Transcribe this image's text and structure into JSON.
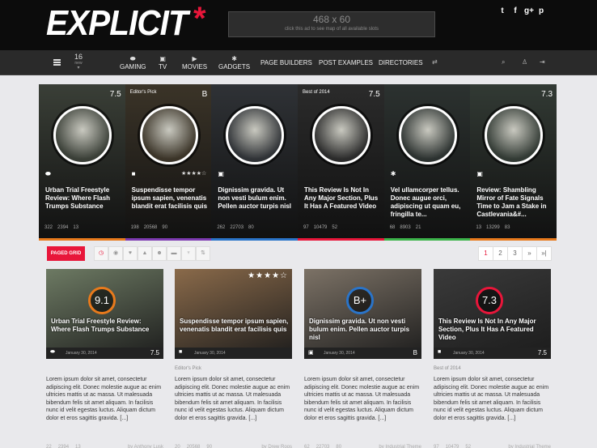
{
  "logo": {
    "text": "EXPLICIT",
    "star": "*"
  },
  "ad": {
    "size": "468 x 60",
    "note": "click this ad to see map of all available slots"
  },
  "social": [
    "t",
    "f",
    "g+",
    "p"
  ],
  "nav": {
    "counter": "16",
    "counter_sub": "new",
    "items": [
      {
        "label": "GAMING",
        "icon": "gamepad-icon",
        "glyph": "⬬"
      },
      {
        "label": "TV",
        "icon": "tv-icon",
        "glyph": "▣"
      },
      {
        "label": "MOVIES",
        "icon": "film-icon",
        "glyph": "▶"
      },
      {
        "label": "GADGETS",
        "icon": "gear-icon",
        "glyph": "✱"
      }
    ],
    "links": [
      "PAGE BUILDERS",
      "POST EXAMPLES",
      "DIRECTORIES"
    ]
  },
  "board": [
    {
      "score": "7.5",
      "badge": "",
      "cat": "gamepad",
      "title": "Urban Trial Freestyle Review: Where Flash Trumps Substance",
      "views": "322",
      "likes": "2394",
      "comments": "13",
      "color": "#e87a1c",
      "bg": "#3a3f37"
    },
    {
      "score": "B",
      "badge": "Editor's Pick",
      "cat": "video",
      "title": "Suspendisse tempor ipsum sapien, venenatis blandit erat facilisis quis",
      "views": "198",
      "likes": "20568",
      "comments": "90",
      "color": "#7d3ab0",
      "bg": "#3b3428",
      "stars": "★★★★☆"
    },
    {
      "score": "",
      "badge": "",
      "cat": "tv",
      "title": "Dignissim gravida. Ut non vesti bulum enim. Pellen auctor turpis nisl",
      "views": "262",
      "likes": "22703",
      "comments": "80",
      "color": "#2a74c9",
      "bg": "#2f3236"
    },
    {
      "score": "7.5",
      "badge": "Best of 2014",
      "cat": "",
      "title": "This Review Is Not In Any Major Section, Plus It Has A Featured Video",
      "views": "97",
      "likes": "10479",
      "comments": "52",
      "color": "#e8163a",
      "bg": "#2b2b2b"
    },
    {
      "score": "",
      "badge": "",
      "cat": "gear",
      "title": "Vel ullamcorper tellus. Donec augue orci, adipiscing ut quam eu, fringilla te...",
      "views": "68",
      "likes": "8903",
      "comments": "21",
      "color": "#3cb34a",
      "bg": "#2c3230"
    },
    {
      "score": "7.3",
      "badge": "",
      "cat": "tv",
      "title": "Review: Shambling Mirror of Fate Signals Time to Jam a Stake in Castlevania&#...",
      "views": "13",
      "likes": "13299",
      "comments": "83",
      "color": "#e87a1c",
      "bg": "#323a34"
    }
  ],
  "filter": {
    "label": "PAGED GRID",
    "pages": [
      "1",
      "2",
      "3",
      "»",
      "»|"
    ]
  },
  "cards": [
    {
      "gauge": "9.1",
      "gauge_color": "#e87a1c",
      "title": "Urban Trial Freestyle Review: Where Flash Trumps Substance",
      "date": "January 30, 2014",
      "rating": "7.5",
      "sub": "",
      "bg": "#6d7a63",
      "views": "22",
      "likes": "2394",
      "comments": "13",
      "author": "by Anthony Lusk"
    },
    {
      "gauge": "",
      "gauge_color": "",
      "title": "Suspendisse tempor ipsum sapien, venenatis blandit erat facilisis quis",
      "date": "January 30, 2014",
      "rating": "★★★★☆",
      "sub": "Editor's Pick",
      "bg": "#8a6a4a",
      "views": "20",
      "likes": "20568",
      "comments": "90",
      "author": "by Drew Roos"
    },
    {
      "gauge": "B+",
      "gauge_color": "#2a74c9",
      "title": "Dignissim gravida. Ut non vesti bulum enim. Pellen auctor turpis nisl",
      "date": "January 30, 2014",
      "rating": "B",
      "sub": "",
      "bg": "#7c7266",
      "views": "62",
      "likes": "22703",
      "comments": "80",
      "author": "by Industrial Theme"
    },
    {
      "gauge": "7.3",
      "gauge_color": "#e8163a",
      "title": "This Review Is Not In Any Major Section, Plus It Has A Featured Video",
      "date": "January 30, 2014",
      "rating": "7.5",
      "sub": "Best of 2014",
      "bg": "#3a3a3a",
      "views": "97",
      "likes": "10479",
      "comments": "52",
      "author": "by Industrial Theme"
    }
  ],
  "lorem": "Lorem ipsum dolor sit amet, consectetur adipiscing elit. Donec molestie augue ac enim ultricies mattis ut ac massa. Ut malesuada bibendum felis sit amet aliquam. In facilisis nunc id velit egestas luctus. Aliquam dictum dolor et eros sagittis gravida. [...]"
}
